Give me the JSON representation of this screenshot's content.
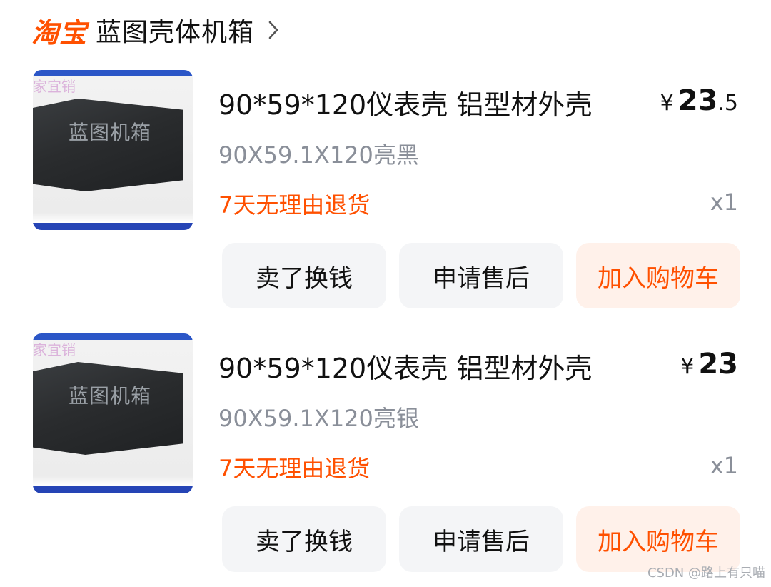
{
  "shop": {
    "platform": "淘宝",
    "name": "蓝图壳体机箱"
  },
  "items": [
    {
      "thumb_watermark": "家宜销",
      "thumb_label": "蓝图机箱",
      "title": "90*59*120仪表壳 铝型材外壳",
      "spec": "90X59.1X120亮黑",
      "policy": "7天无理由退货",
      "currency": "¥",
      "price_int": "23",
      "price_dec": ".5",
      "quantity": "x1",
      "actions": {
        "sell": "卖了换钱",
        "after_sale": "申请售后",
        "add_to_cart": "加入购物车"
      }
    },
    {
      "thumb_watermark": "家宜销",
      "thumb_label": "蓝图机箱",
      "title": "90*59*120仪表壳 铝型材外壳",
      "spec": "90X59.1X120亮银",
      "policy": "7天无理由退货",
      "currency": "¥",
      "price_int": "23",
      "price_dec": "",
      "quantity": "x1",
      "actions": {
        "sell": "卖了换钱",
        "after_sale": "申请售后",
        "add_to_cart": "加入购物车"
      }
    }
  ],
  "watermark": "CSDN @路上有只喵",
  "colors": {
    "brand": "#ff5000",
    "text": "#111111",
    "muted": "#8a8f99",
    "button_bg": "#f4f5f7",
    "button_primary_bg": "#fff1ea"
  }
}
